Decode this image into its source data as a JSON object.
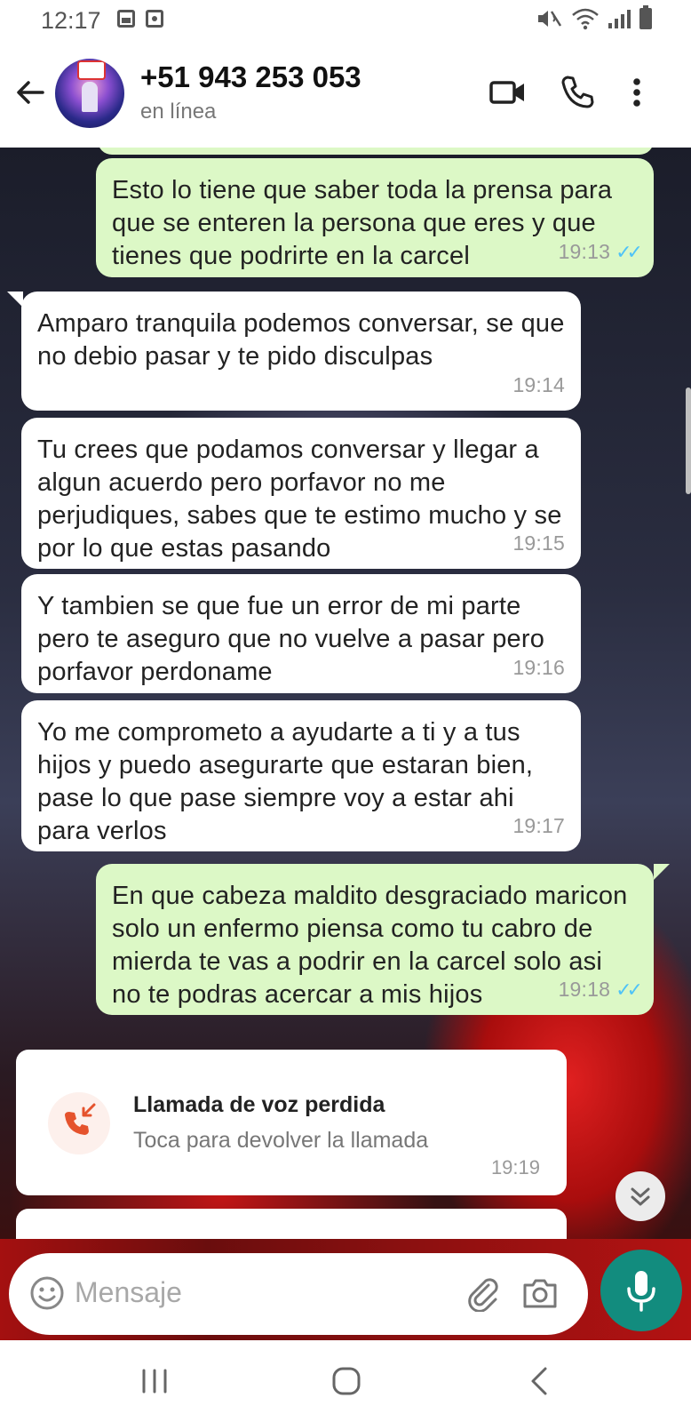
{
  "status_bar": {
    "time": "12:17"
  },
  "header": {
    "contact_name": "+51 943 253 053",
    "contact_status": "en línea"
  },
  "messages": [
    {
      "direction": "out",
      "text": "Esto lo tiene que saber toda la prensa para que se enteren la persona que eres y que tienes que podrirte en la carcel",
      "time": "19:13",
      "read": true
    },
    {
      "direction": "in",
      "text": "Amparo tranquila podemos conversar, se que no debio pasar y te pido disculpas",
      "time": "19:14"
    },
    {
      "direction": "in",
      "text": "Tu crees que podamos conversar y llegar a algun acuerdo pero porfavor no me perjudiques, sabes que te estimo mucho y se por lo que estas pasando",
      "time": "19:15"
    },
    {
      "direction": "in",
      "text": "Y tambien se que fue un error de mi parte pero te aseguro que no vuelve a pasar pero porfavor perdoname",
      "time": "19:16"
    },
    {
      "direction": "in",
      "text": "Yo me comprometo a ayudarte a ti y a tus hijos y puedo asegurarte que estaran bien, pase lo que pase siempre voy a estar ahi para verlos",
      "time": "19:17"
    },
    {
      "direction": "out",
      "text": "En que cabeza maldito desgraciado maricon solo un enfermo piensa como tu cabro de mierda te vas a podrir en la carcel solo asi no te podras acercar a mis hijos",
      "time": "19:18",
      "read": true
    }
  ],
  "missed_call": {
    "title": "Llamada de voz perdida",
    "subtitle": "Toca para devolver la llamada",
    "time": "19:19"
  },
  "input": {
    "placeholder": "Mensaje"
  },
  "colors": {
    "outgoing_bubble": "#dcf8c6",
    "incoming_bubble": "#ffffff",
    "accent": "#128c7e",
    "read_ticks": "#4fc3f7",
    "missed_call": "#e5532d"
  },
  "icons": {
    "header": [
      "back-arrow-icon",
      "video-call-icon",
      "voice-call-icon",
      "more-options-icon"
    ],
    "input": [
      "emoji-icon",
      "attach-icon",
      "camera-icon",
      "mic-icon"
    ]
  }
}
